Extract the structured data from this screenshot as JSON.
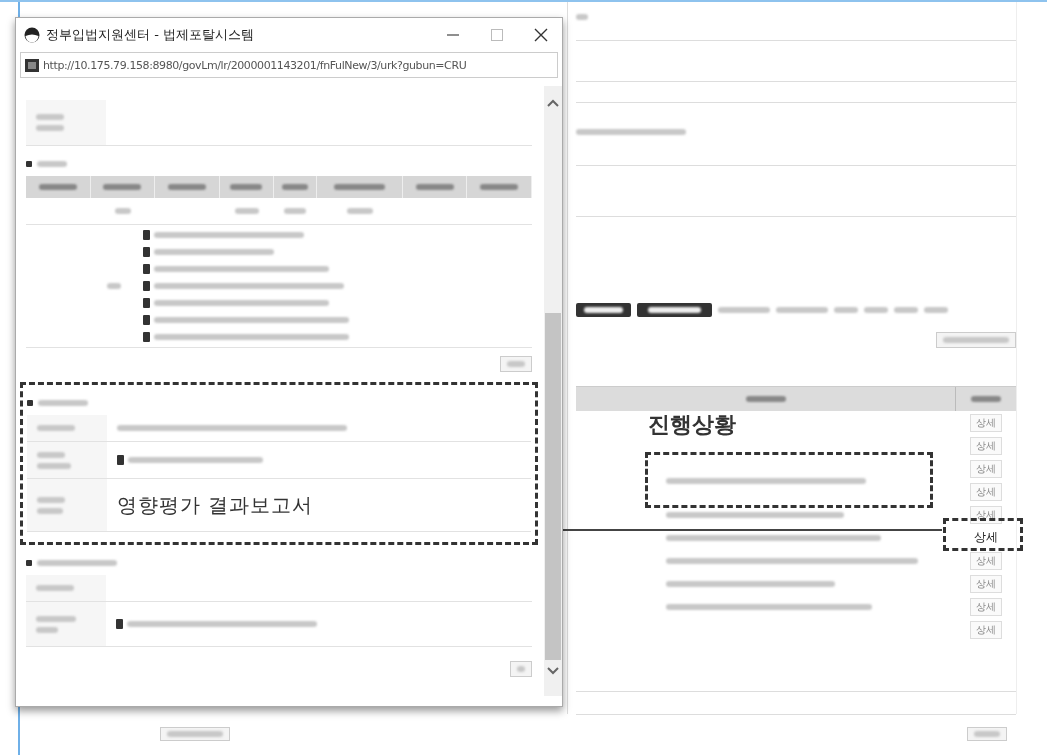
{
  "popup": {
    "title": "정부입법지원센터 - 법제포탈시스템",
    "url": "http://10.175.79.158:8980/govLm/lr/2000001143201/fnFulNew/3/urk?gubun=CRU",
    "impact_caption": "영향평가 결과보고서"
  },
  "main": {
    "progress_caption": "진행상황",
    "rows": [
      {
        "button": "상세",
        "highlighted": false
      },
      {
        "button": "상세",
        "highlighted": false
      },
      {
        "button": "상세",
        "highlighted": false
      },
      {
        "button": "상세",
        "highlighted": false
      },
      {
        "button": "상세",
        "highlighted": false
      },
      {
        "button": "상세",
        "highlighted": true
      },
      {
        "button": "상세",
        "highlighted": false
      },
      {
        "button": "상세",
        "highlighted": false
      },
      {
        "button": "상세",
        "highlighted": false
      },
      {
        "button": "상세",
        "highlighted": false
      }
    ]
  }
}
